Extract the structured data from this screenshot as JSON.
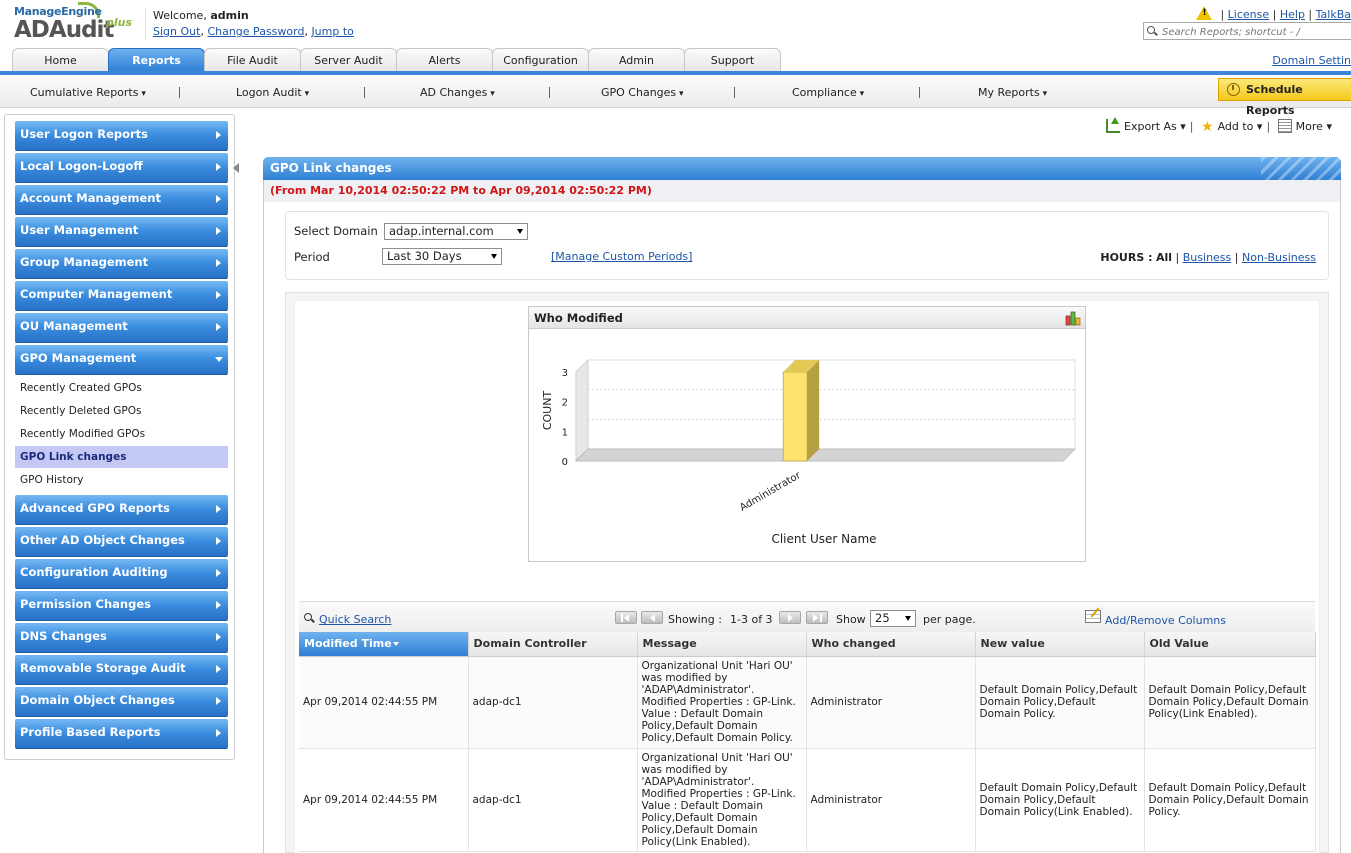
{
  "header": {
    "brand": "ManageEngine",
    "product": "ADAudit",
    "product_suffix": "plus",
    "welcome_prefix": "Welcome,",
    "username": "admin",
    "sign_out": "Sign Out",
    "change_password": "Change Password",
    "jump_to": "Jump to",
    "license": "License",
    "help": "Help",
    "talkback": "TalkBa",
    "search_placeholder": "Search Reports; shortcut - /",
    "domain_settings": "Domain Settin"
  },
  "main_tabs": [
    "Home",
    "Reports",
    "File Audit",
    "Server Audit",
    "Alerts",
    "Configuration",
    "Admin",
    "Support"
  ],
  "active_tab": "Reports",
  "sub_nav": [
    "Cumulative Reports",
    "Logon Audit",
    "AD Changes",
    "GPO Changes",
    "Compliance",
    "My Reports"
  ],
  "schedule_reports": "Schedule Reports",
  "sidebar": {
    "items_before": [
      "User Logon Reports",
      "Local Logon-Logoff",
      "Account Management",
      "User Management",
      "Group Management",
      "Computer Management",
      "OU Management"
    ],
    "expanded": "GPO Management",
    "sub_items": [
      "Recently Created GPOs",
      "Recently Deleted GPOs",
      "Recently Modified GPOs",
      "GPO Link changes",
      "GPO History"
    ],
    "active_sub": "GPO Link changes",
    "items_after": [
      "Advanced GPO Reports",
      "Other AD Object Changes",
      "Configuration Auditing",
      "Permission Changes",
      "DNS Changes",
      "Removable Storage Audit",
      "Domain Object Changes",
      "Profile Based Reports"
    ]
  },
  "toolbar": {
    "export": "Export As",
    "add_to": "Add to",
    "more": "More"
  },
  "report": {
    "title": "GPO Link changes",
    "date_range": "(From Mar 10,2014 02:50:22 PM to Apr 09,2014 02:50:22 PM)",
    "select_domain_label": "Select Domain",
    "domain_value": "adap.internal.com",
    "period_label": "Period",
    "period_value": "Last 30 Days",
    "manage_custom": "[Manage Custom Periods]",
    "hours_label": "HOURS :",
    "hours_all": "All",
    "hours_business": "Business",
    "hours_nonbusiness": "Non-Business"
  },
  "chart_data": {
    "type": "bar",
    "title": "Who Modified",
    "categories": [
      "Administrator"
    ],
    "values": [
      3
    ],
    "xlabel": "Client User Name",
    "ylabel": "COUNT",
    "ylim": [
      0,
      3
    ],
    "yticks": [
      0,
      1,
      2,
      3
    ],
    "colors": {
      "bar_front": "#fde36e",
      "bar_side": "#b5a043",
      "floor": "#d4d4d4"
    }
  },
  "table": {
    "quick_search": "Quick Search",
    "showing_label": "Showing :",
    "showing_value": "1-3 of 3",
    "show_label": "Show",
    "per_page_value": "25",
    "per_page_suffix": "per page.",
    "add_remove": "Add/Remove Columns",
    "columns": [
      "Modified Time",
      "Domain Controller",
      "Message",
      "Who changed",
      "New value",
      "Old Value"
    ],
    "rows": [
      {
        "time": "Apr 09,2014 02:44:55 PM",
        "dc": "adap-dc1",
        "message": "Organizational Unit 'Hari OU' was modified by 'ADAP\\Administrator'. Modified Properties : GP-Link. Value : Default Domain Policy,Default Domain Policy,Default Domain Policy.",
        "who": "Administrator",
        "new_value": "Default Domain Policy,Default Domain Policy,Default Domain Policy.",
        "old_value": "Default Domain Policy,Default Domain Policy,Default Domain Policy(Link Enabled)."
      },
      {
        "time": "Apr 09,2014 02:44:55 PM",
        "dc": "adap-dc1",
        "message": "Organizational Unit 'Hari OU' was modified by 'ADAP\\Administrator'. Modified Properties : GP-Link. Value : Default Domain Policy,Default Domain Policy,Default Domain Policy(Link Enabled).",
        "who": "Administrator",
        "new_value": "Default Domain Policy,Default Domain Policy,Default Domain Policy(Link Enabled).",
        "old_value": "Default Domain Policy,Default Domain Policy,Default Domain Policy."
      }
    ]
  }
}
